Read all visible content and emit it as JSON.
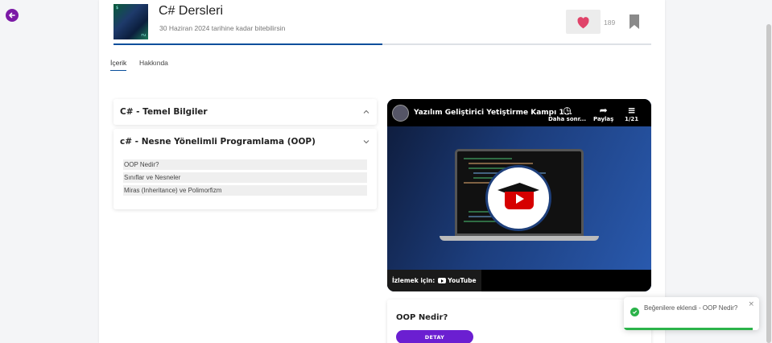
{
  "course": {
    "title": "C# Dersleri",
    "subtitle": "30 Haziran 2024 tarihine kadar bitebilirsin",
    "thumb_text_top": "$",
    "thumb_text_bottom": "ru",
    "progress": 0.5,
    "likes": "189"
  },
  "tabs": [
    {
      "label": "İçerik",
      "active": true
    },
    {
      "label": "Hakkında",
      "active": false
    }
  ],
  "sections": [
    {
      "title": "C# - Temel Bilgiler",
      "expanded": false,
      "items": []
    },
    {
      "title": "c# - Nesne Yönelimli Programlama (OOP)",
      "expanded": true,
      "items": [
        "OOP Nedir?",
        "Sınıflar ve Nesneler",
        "Miras (Inheritance) ve Polimorfizm"
      ]
    }
  ],
  "video": {
    "title": "Yazılım Geliştirici Yetiştirme Kampı 1...",
    "watch_later": "Daha sonr...",
    "share": "Paylaş",
    "playlist": "1/21",
    "watch_on": "İzlemek için:",
    "youtube": "YouTube"
  },
  "detail": {
    "title": "OOP Nedir?",
    "button": "DETAY"
  },
  "toast": {
    "message": "Beğenilere eklendi - OOP Nedir?",
    "close": "×",
    "progress": 0.95
  },
  "colors": {
    "accent": "#0a4f9c",
    "brand_purple": "#7b1aa6",
    "button_purple": "#6b1fd1",
    "heart": "#e0446a",
    "success": "#2bb34a"
  }
}
